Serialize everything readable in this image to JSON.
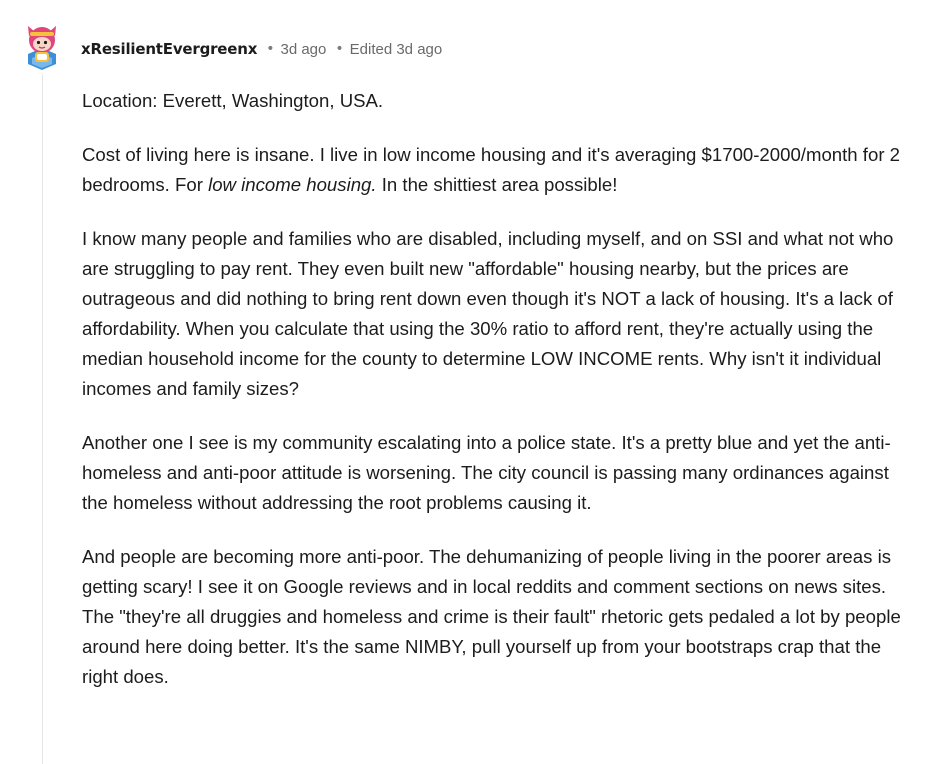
{
  "comment": {
    "author": "xResilientEvergreenx",
    "time": "3d ago",
    "edited": "Edited 3d ago",
    "separator": "•",
    "paragraphs": [
      {
        "text": "Location: Everett, Washington, USA."
      },
      {
        "before": "Cost of living here is insane. I live in low income housing and it's averaging $1700-2000/month for 2 bedrooms. For ",
        "emphasis": "low income housing.",
        "after": " In the shittiest area possible!"
      },
      {
        "text": "I know many people and families who are disabled, including myself, and on SSI and what not who are struggling to pay rent. They even built new \"affordable\" housing nearby, but the prices are outrageous and did nothing to bring rent down even though it's NOT a lack of housing. It's a lack of affordability. When you calculate that using the 30% ratio to afford rent, they're actually using the median household income for the county to determine LOW INCOME rents. Why isn't it individual incomes and family sizes?"
      },
      {
        "text": "Another one I see is my community escalating into a police state. It's a pretty blue and yet the anti-homeless and anti-poor attitude is worsening. The city council is passing many ordinances against the homeless without addressing the root problems causing it."
      },
      {
        "text": "And people are becoming more anti-poor. The dehumanizing of people living in the poorer areas is getting scary! I see it on Google reviews and in local reddits and comment sections on news sites. The \"they're all druggies and homeless and crime is their fault\" rhetoric gets pedaled a lot by people around here doing better. It's the same NIMBY, pull yourself up from your bootstraps crap that the right does."
      }
    ]
  },
  "colors": {
    "text": "#1c1c1c",
    "meta": "#6a6a6a",
    "thread_line": "#e5e6e8",
    "avatar_pink": "#e0457b",
    "avatar_blue": "#3d8fd8"
  }
}
